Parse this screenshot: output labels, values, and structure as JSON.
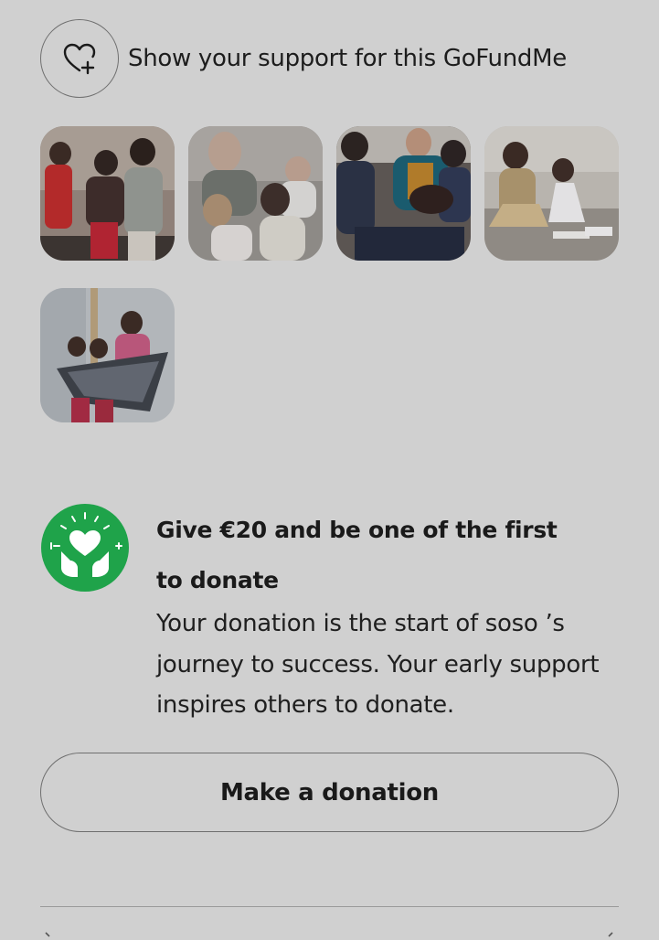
{
  "support": {
    "label": "Show your support for this GoFundMe",
    "icon": "heart-plus-icon"
  },
  "photos": [
    {
      "name": "gallery-photo-1",
      "desc": "children group"
    },
    {
      "name": "gallery-photo-2",
      "desc": "man with kids"
    },
    {
      "name": "gallery-photo-3",
      "desc": "family with cake"
    },
    {
      "name": "gallery-photo-4",
      "desc": "girls on stairs"
    },
    {
      "name": "gallery-photo-5",
      "desc": "children with scarf"
    }
  ],
  "give": {
    "title": "Give €20 and be one of the first to donate",
    "description": "Your donation is the start of soso ’s journey to success. Your early support inspires others to donate.",
    "icon": "hands-heart-icon",
    "icon_color": "#1fa34a"
  },
  "donate_button": {
    "label": "Make a donation"
  }
}
